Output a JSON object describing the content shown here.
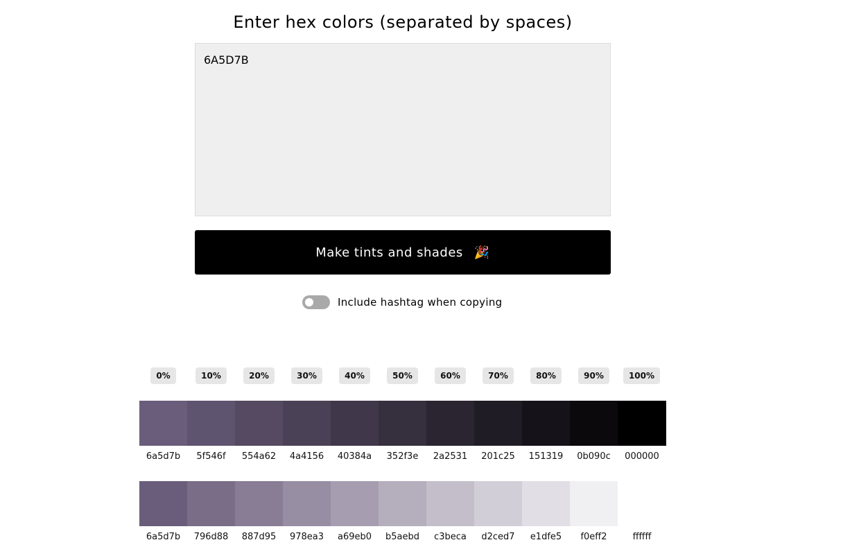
{
  "heading": "Enter hex colors (separated by spaces)",
  "input": {
    "value": "6A5D7B"
  },
  "make_button": {
    "label": "Make tints and shades",
    "icon": "party-popper-icon"
  },
  "hashtag_toggle": {
    "label": "Include hashtag when copying",
    "checked": false
  },
  "percentages": [
    "0%",
    "10%",
    "20%",
    "30%",
    "40%",
    "50%",
    "60%",
    "70%",
    "80%",
    "90%",
    "100%"
  ],
  "shades": [
    "6a5d7b",
    "5f546f",
    "554a62",
    "4a4156",
    "40384a",
    "352f3e",
    "2a2531",
    "201c25",
    "151319",
    "0b090c",
    "000000"
  ],
  "tints": [
    "6a5d7b",
    "796d88",
    "887d95",
    "978ea3",
    "a69eb0",
    "b5aebd",
    "c3beca",
    "d2ced7",
    "e1dfe5",
    "f0eff2",
    "ffffff"
  ]
}
